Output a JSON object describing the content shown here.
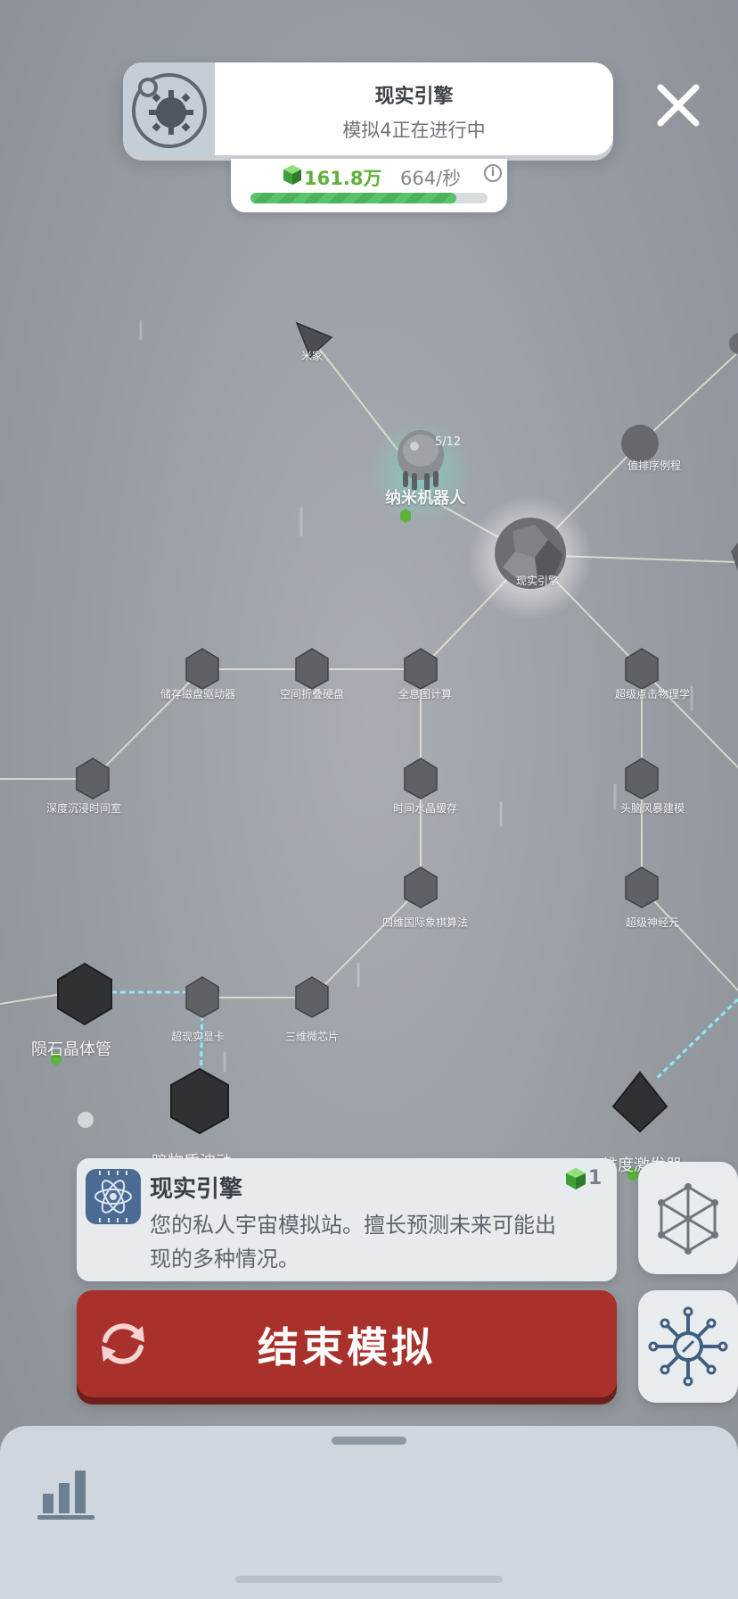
{
  "banner": {
    "title": "现实引擎",
    "subtitle": "模拟4正在进行中",
    "icon": "sun-gear-icon"
  },
  "close_icon": "close-icon",
  "currency": {
    "amount": "161.8万",
    "rate": "664/秒",
    "progress": 0.87,
    "icon": "green-gem-icon",
    "info_icon": "info-icon"
  },
  "tree": {
    "labels": {
      "mijia": "米家",
      "nano_robot": "纳米机器人",
      "nano_robot_count": "5/12",
      "sort_routine": "值排序例程",
      "reality_engine": "现实引擎",
      "storage_drive": "储存磁盘驱动器",
      "fold_disk": "空间折叠硬盘",
      "holo_compute": "全息图计算",
      "super_click_physics": "超级点击物理学",
      "deep_immersion": "深度沉浸时间室",
      "time_crystal": "时间水晶缓存",
      "brainstorm": "头脑风暴建模",
      "chess_4d": "四维国际象棋算法",
      "super_neuron": "超级神经元",
      "meteor_tube": "陨石晶体管",
      "hyper_card": "超现实显卡",
      "chip_3d": "三维微芯片",
      "dark_matter": "暗物质波动",
      "dimension_exciter": "维度激发器"
    }
  },
  "info_card": {
    "title": "现实引擎",
    "description": "您的私人宇宙模拟站。擅长预测未来可能出现的多种情况。",
    "level": "1",
    "icon": "atom-chip-icon",
    "gem_icon": "green-gem-icon"
  },
  "side_buttons": {
    "top_icon": "polyhedron-icon",
    "bottom_icon": "network-node-icon"
  },
  "end_button": {
    "label": "结束模拟",
    "icon": "refresh-icon"
  },
  "bottom_sheet": {
    "icon": "bar-chart-icon"
  },
  "colors": {
    "accent_green": "#5cb23a",
    "end_button_red": "#a8312c",
    "info_card_bg": "#e8ebee"
  }
}
